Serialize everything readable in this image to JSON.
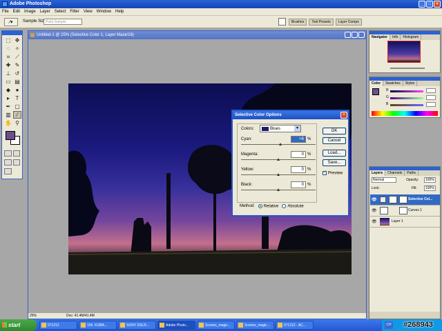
{
  "app": {
    "title": "Adobe Photoshop"
  },
  "menu": [
    "File",
    "Edit",
    "Image",
    "Layer",
    "Select",
    "Filter",
    "View",
    "Window",
    "Help"
  ],
  "options_bar": {
    "sample_size_label": "Sample Size:",
    "sample_size_value": "Point Sample"
  },
  "palette_well": [
    "Brushes",
    "Tool Presets",
    "Layer Comps"
  ],
  "colors": {
    "foreground": "#6a4f8d",
    "background": "#ffffff",
    "title_bar": "#2a62d6"
  },
  "document": {
    "title": "Untitled-1 @ 25% (Selective Color 1, Layer Mask/16)",
    "zoom": "25%",
    "doc_size": "Doc: 41.4M/41.4M"
  },
  "dialog": {
    "title": "Selective Color Options",
    "colors_label": "Colors:",
    "colors_value": "Blues",
    "sliders": [
      {
        "label": "Cyan:",
        "value": "+6",
        "percent": "%",
        "level": 0.53
      },
      {
        "label": "Magenta:",
        "value": "0",
        "percent": "%",
        "level": 0.5
      },
      {
        "label": "Yellow:",
        "value": "0",
        "percent": "%",
        "level": 0.5
      },
      {
        "label": "Black:",
        "value": "0",
        "percent": "%",
        "level": 0.5
      }
    ],
    "buttons": {
      "ok": "OK",
      "cancel": "Cancel",
      "load": "Load...",
      "save": "Save..."
    },
    "preview_label": "Preview",
    "method_label": "Method:",
    "relative_label": "Relative",
    "absolute_label": "Absolute"
  },
  "navigator": {
    "tabs": [
      "Navigator",
      "Info",
      "Histogram"
    ]
  },
  "color_palette": {
    "tabs": [
      "Color",
      "Swatches",
      "Styles"
    ],
    "channels": [
      "R",
      "G",
      "B"
    ]
  },
  "layers": {
    "tabs": [
      "Layers",
      "Channels",
      "Paths"
    ],
    "blend_mode": "Normal",
    "opacity_label": "Opacity:",
    "opacity_value": "100%",
    "lock_label": "Lock:",
    "fill_label": "Fill:",
    "fill_value": "100%",
    "items": [
      {
        "name": "Selective Col..."
      },
      {
        "name": "Curves 1"
      },
      {
        "name": "Layer 1"
      }
    ]
  },
  "taskbar": {
    "start": "start",
    "tasks": [
      "071212",
      "155. KOBA...",
      "SONY DSLR...",
      "Adobe Photo...",
      "Scenes_magic...",
      "Scenes_magic...",
      "071212 - AC..."
    ],
    "language": "CH"
  },
  "watermark": "#268943"
}
